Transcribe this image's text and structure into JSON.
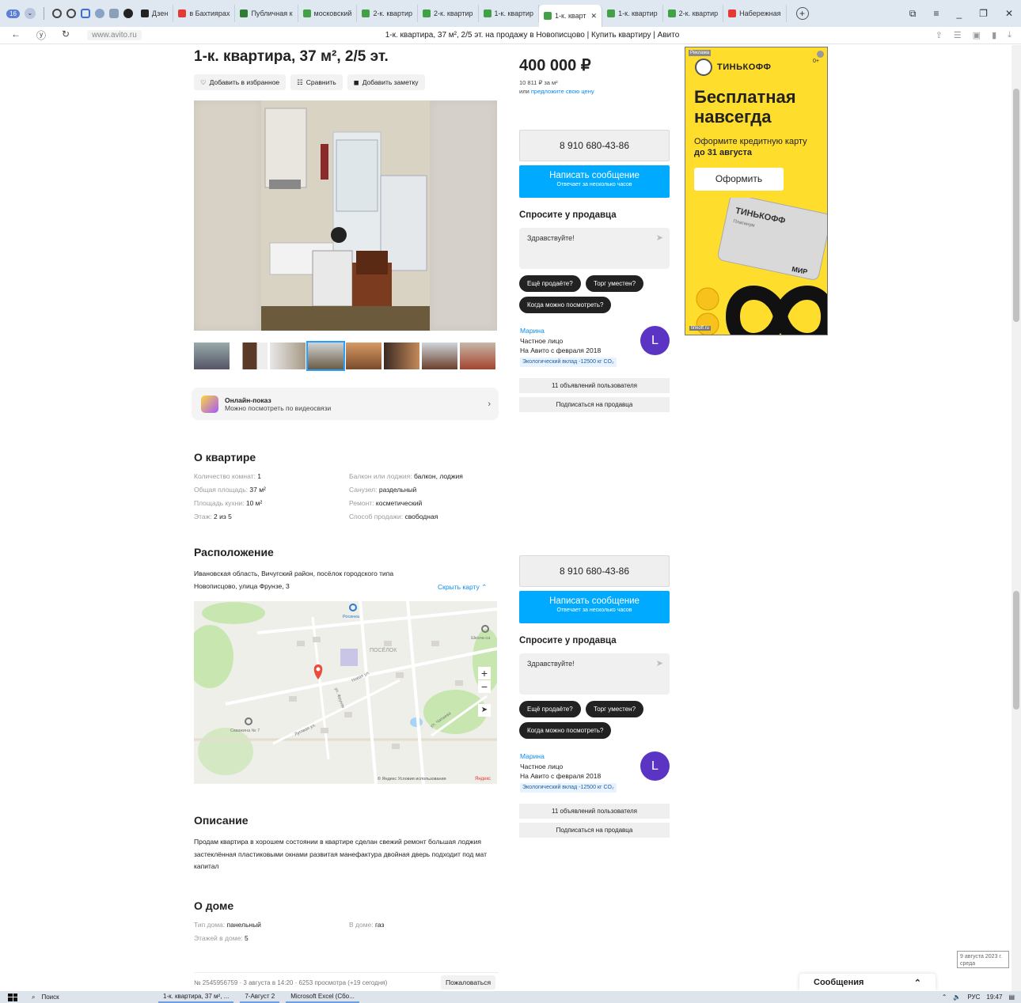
{
  "browser": {
    "tab_count": "16",
    "tabs": [
      {
        "label": "Дзен",
        "color": "#222222"
      },
      {
        "label": "в Бахтиярах",
        "color": "#e53935"
      },
      {
        "label": "Публичная к",
        "color": "#2e7d32"
      },
      {
        "label": "московский",
        "color": "#43a047"
      },
      {
        "label": "2-к. квартир",
        "color": "#43a047"
      },
      {
        "label": "2-к. квартир",
        "color": "#43a047"
      },
      {
        "label": "1-к. квартир",
        "color": "#43a047"
      },
      {
        "label": "1-к. кварт",
        "color": "#43a047",
        "active": true
      },
      {
        "label": "1-к. квартир",
        "color": "#43a047"
      },
      {
        "label": "2-к. квартир",
        "color": "#43a047"
      },
      {
        "label": "Набережная",
        "color": "#e53935"
      }
    ],
    "url": "www.avito.ru",
    "page_title": "1-к. квартира, 37 м², 2/5 эт. на продажу в Новописцово | Купить квартиру | Авито"
  },
  "listing": {
    "title": "1-к. квартира, 37 м², 2/5 эт.",
    "actions": [
      "Добавить в избранное",
      "Сравнить",
      "Добавить заметку"
    ],
    "online_show": {
      "title": "Онлайн-показ",
      "subtitle": "Можно посмотреть по видеосвязи"
    },
    "about": {
      "heading": "О квартире",
      "left": [
        {
          "k": "Количество комнат: ",
          "v": "1"
        },
        {
          "k": "Общая площадь: ",
          "v": "37 м²"
        },
        {
          "k": "Площадь кухни: ",
          "v": "10 м²"
        },
        {
          "k": "Этаж: ",
          "v": "2 из 5"
        }
      ],
      "right": [
        {
          "k": "Балкон или лоджия: ",
          "v": "балкон, лоджия"
        },
        {
          "k": "Санузел: ",
          "v": "раздельный"
        },
        {
          "k": "Ремонт: ",
          "v": "косметический"
        },
        {
          "k": "Способ продажи: ",
          "v": "свободная"
        }
      ]
    },
    "location": {
      "heading": "Расположение",
      "address_line1": "Ивановская область, Вичугский район, посёлок городского типа",
      "address_line2": "Новописцово, улица Фрунзе, 3",
      "hide_map": "Скрыть карту ⌃",
      "map_labels": {
        "settlement": "ПОСЁЛОК",
        "rosinka": "Росинка",
        "school": "Школа-са",
        "well": "Скважина № 7",
        "street_novaya": "Новая ул.",
        "street_lugovaya": "Луговая ул.",
        "street_chapaeva": "ул. Чапаева",
        "street_frunze": "ул. Фрунзе",
        "copyright": "© Яндекс Условия использования",
        "yandex": "Яндекс"
      }
    },
    "description": {
      "heading": "Описание",
      "text": "Продам квартира в хорошем состоянии в квартире сделан свежий ремонт большая лоджия застеклённая пластиковыми окнами развитая манефактура двойная дверь подходит под мат капитал"
    },
    "house": {
      "heading": "О доме",
      "left": [
        {
          "k": "Тип дома: ",
          "v": "панельный"
        },
        {
          "k": "Этажей в доме: ",
          "v": "5"
        }
      ],
      "right": [
        {
          "k": "В доме: ",
          "v": "газ"
        }
      ]
    },
    "footer": {
      "meta": "№ 2545956759 · 3 августа в 14:20 · 6253 просмотра (+19 сегодня)",
      "complain": "Пожаловаться"
    }
  },
  "sidebar": {
    "price": "400 000 ₽",
    "price_per_m": "10 811 ₽ за м²",
    "offer_prefix": "или ",
    "offer_link": "предложите свою цену",
    "phone": "8 910 680-43-86",
    "message_button": "Написать сообщение",
    "message_sub": "Отвечает за несколько часов",
    "ask_heading": "Спросите у продавца",
    "ask_placeholder": "Здравствуйте!",
    "chips": [
      "Ещё продаёте?",
      "Торг уместен?",
      "Когда можно посмотреть?"
    ],
    "seller": {
      "name": "Марина",
      "type": "Частное лицо",
      "since": "На Авито с февраля 2018",
      "eco": "Экологический вклад -12500 кг CO₂",
      "avatar_letter": "L"
    },
    "user_ads": "11 объявлений пользователя",
    "subscribe": "Подписаться на продавца"
  },
  "ad": {
    "label": "Реклама",
    "brand": "ТИНЬКОФФ",
    "age": "0+",
    "headline_1": "Бесплатная",
    "headline_2": "навсегда",
    "sub_1": "Оформите кредитную карту",
    "sub_2": "до 31 августа",
    "cta": "Оформить",
    "card_brand": "ТИНЬКОФФ",
    "card_tier": "Платинум",
    "card_pay": "МИР",
    "domain": "tinkoff.ru"
  },
  "messages_popup": {
    "label": "Сообщения"
  },
  "date_tooltip": {
    "line1": "9 августа 2023 г.",
    "line2": "среда"
  },
  "taskbar": {
    "search": "Поиск",
    "tasks": [
      "1-к. квартира, 37 м², ...",
      "7-Август 2",
      "Microsoft Excel (Сбо..."
    ],
    "lang": "РУС",
    "time": "19:47"
  }
}
